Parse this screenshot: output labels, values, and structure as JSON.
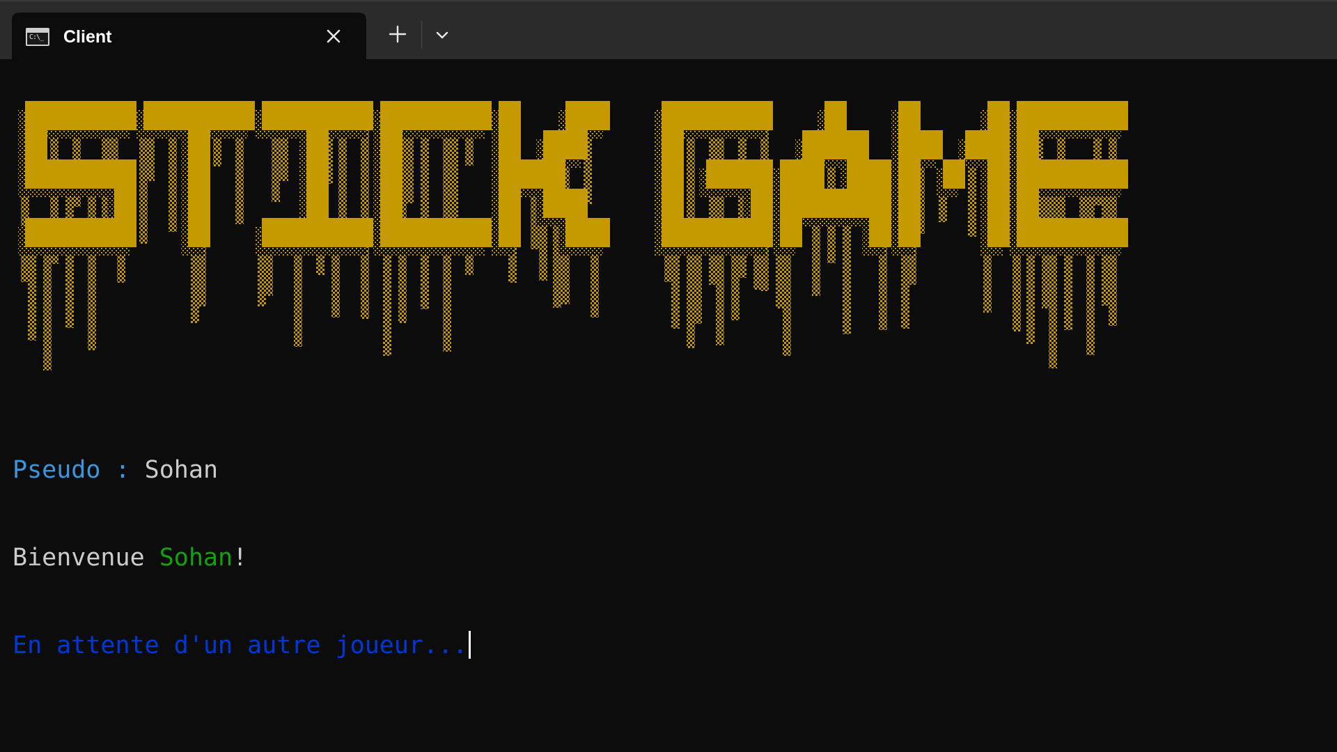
{
  "window": {
    "tab_title": "Client",
    "tab_icon": "terminal-icon",
    "icons": {
      "close": "close-icon",
      "new_tab": "plus-icon",
      "dropdown": "chevron-down-icon"
    }
  },
  "terminal": {
    "banner_text": "STICK GAME",
    "banner_color": "#c49a00",
    "lines": {
      "pseudo_label": "Pseudo : ",
      "pseudo_value": "Sohan",
      "welcome_prefix": "Bienvenue ",
      "welcome_name": "Sohan",
      "welcome_suffix": "!",
      "waiting": "En attente d'un autre joueur..."
    },
    "colors": {
      "cyan": "#3a96dd",
      "white": "#cccccc",
      "green": "#13a10e",
      "blue": "#0037da",
      "background": "#0c0c0c"
    }
  }
}
